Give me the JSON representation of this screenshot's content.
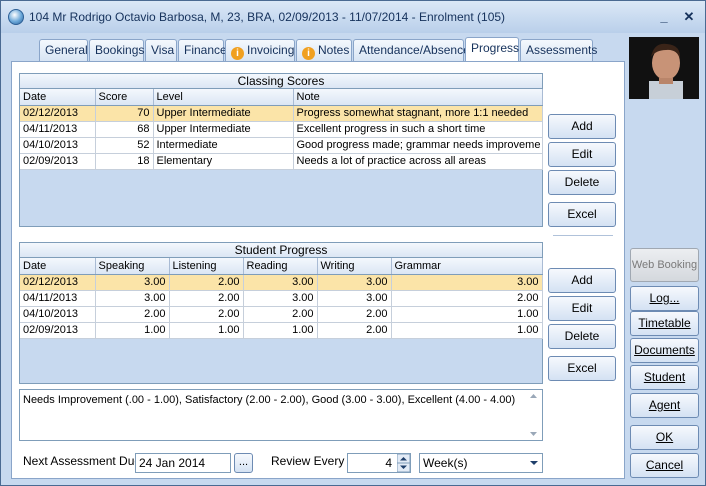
{
  "window": {
    "title": "104 Mr Rodrigo Octavio Barbosa, M, 23, BRA, 02/09/2013 - 11/07/2014 - Enrolment (105)",
    "minimize_glyph": "_",
    "close_glyph": "✕"
  },
  "tabs": [
    {
      "label": "General",
      "warn": false
    },
    {
      "label": "Bookings",
      "warn": false
    },
    {
      "label": "Visa",
      "warn": false
    },
    {
      "label": "Finance",
      "warn": false
    },
    {
      "label": "Invoicing",
      "warn": true
    },
    {
      "label": "Notes",
      "warn": true
    },
    {
      "label": "Attendance/Absence",
      "warn": false
    },
    {
      "label": "Progress",
      "warn": false,
      "active": true
    },
    {
      "label": "Assessments",
      "warn": false
    }
  ],
  "warn_glyph": "i",
  "classing": {
    "caption": "Classing Scores",
    "columns": [
      "Date",
      "Score",
      "Level",
      "Note"
    ],
    "rows": [
      [
        "02/12/2013",
        "70",
        "Upper Intermediate",
        "Progress somewhat stagnant, more 1:1 needed"
      ],
      [
        "04/11/2013",
        "68",
        "Upper Intermediate",
        "Excellent progress in such a short time"
      ],
      [
        "04/10/2013",
        "52",
        "Intermediate",
        "Good progress made; grammar needs improveme"
      ],
      [
        "02/09/2013",
        "18",
        "Elementary",
        "Needs a lot of practice across all areas"
      ]
    ],
    "buttons": {
      "add": "Add",
      "edit": "Edit",
      "delete": "Delete",
      "excel": "Excel"
    }
  },
  "progress": {
    "caption": "Student Progress",
    "columns": [
      "Date",
      "Speaking",
      "Listening",
      "Reading",
      "Writing",
      "Grammar"
    ],
    "rows": [
      [
        "02/12/2013",
        "3.00",
        "2.00",
        "3.00",
        "3.00",
        "3.00"
      ],
      [
        "04/11/2013",
        "3.00",
        "2.00",
        "3.00",
        "3.00",
        "2.00"
      ],
      [
        "04/10/2013",
        "2.00",
        "2.00",
        "2.00",
        "2.00",
        "1.00"
      ],
      [
        "02/09/2013",
        "1.00",
        "1.00",
        "1.00",
        "2.00",
        "1.00"
      ]
    ],
    "buttons": {
      "add": "Add",
      "edit": "Edit",
      "delete": "Delete",
      "excel": "Excel"
    }
  },
  "legend_text": "Needs Improvement (.00 - 1.00), Satisfactory (2.00 - 2.00), Good (3.00 - 3.00), Excellent (4.00 - 4.00)",
  "footer": {
    "next_due_label": "Next Assessment Due",
    "next_due_value": "24 Jan 2014",
    "ellipsis": "...",
    "review_label": "Review Every",
    "review_value": "4",
    "review_unit": "Week(s)"
  },
  "side_buttons": {
    "web_booking": "Web Booking",
    "log": "Log...",
    "timetable": "Timetable",
    "documents": "Documents",
    "student": "Student",
    "agent": "Agent",
    "ok": "OK",
    "cancel": "Cancel"
  },
  "colors": {
    "selected_row": "#fbe4a8",
    "frame": "#c7d9ef",
    "warn": "#f0a020"
  }
}
